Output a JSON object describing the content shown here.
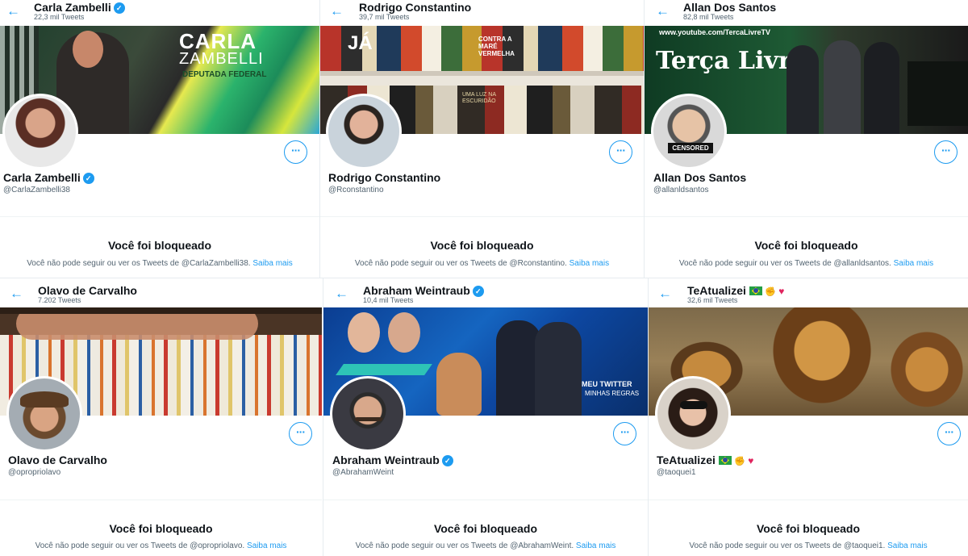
{
  "common": {
    "blocked_title": "Você foi bloqueado",
    "blocked_prefix": "Você não pode seguir ou ver os Tweets de ",
    "learn_more": "Saiba mais",
    "more_label": "···",
    "back_glyph": "←",
    "verified_glyph": "✓"
  },
  "profiles": [
    {
      "name": "Carla Zambelli",
      "handle": "@CarlaZambelli38",
      "tweets": "22,3 mil Tweets",
      "verified": true,
      "blocked_text": "@CarlaZambelli38.",
      "banner_text_1": "CARLA",
      "banner_text_2": "ZAMBELLI",
      "banner_text_3": "DEPUTADA FEDERAL"
    },
    {
      "name": "Rodrigo Constantino",
      "handle": "@Rconstantino",
      "tweets": "39,7 mil Tweets",
      "verified": false,
      "blocked_text": "@Rconstantino.",
      "banner_text_1": "JÁ",
      "banner_text_2": "CONTRA A MARÉ VERMELHA",
      "banner_text_3": "UMA LUZ NA ESCURIDÃO"
    },
    {
      "name": "Allan Dos Santos",
      "handle": "@allanldsantos",
      "tweets": "82,8 mil Tweets",
      "verified": false,
      "blocked_text": "@allanldsantos.",
      "banner_text_1": "www.youtube.com/TercaLivreTV",
      "banner_text_2": "Terça Livre",
      "banner_text_3": "CENSORED"
    },
    {
      "name": "Olavo de Carvalho",
      "handle": "@opropriolavo",
      "tweets": "7.202 Tweets",
      "verified": false,
      "blocked_text": "@opropriolavo.",
      "banner_text_1": "",
      "banner_text_2": "",
      "banner_text_3": ""
    },
    {
      "name": "Abraham Weintraub",
      "handle": "@AbrahamWeint",
      "tweets": "10,4 mil Tweets",
      "verified": true,
      "blocked_text": "@AbrahamWeint.",
      "banner_text_1": "MEU TWITTER",
      "banner_text_2": "MINHAS REGRAS",
      "banner_text_3": ""
    },
    {
      "name": "TeAtualizei",
      "handle": "@taoquei1",
      "tweets": "32,6 mil Tweets",
      "verified": false,
      "blocked_text": "@taoquei1.",
      "banner_text_1": "",
      "banner_text_2": "",
      "banner_text_3": ""
    }
  ]
}
